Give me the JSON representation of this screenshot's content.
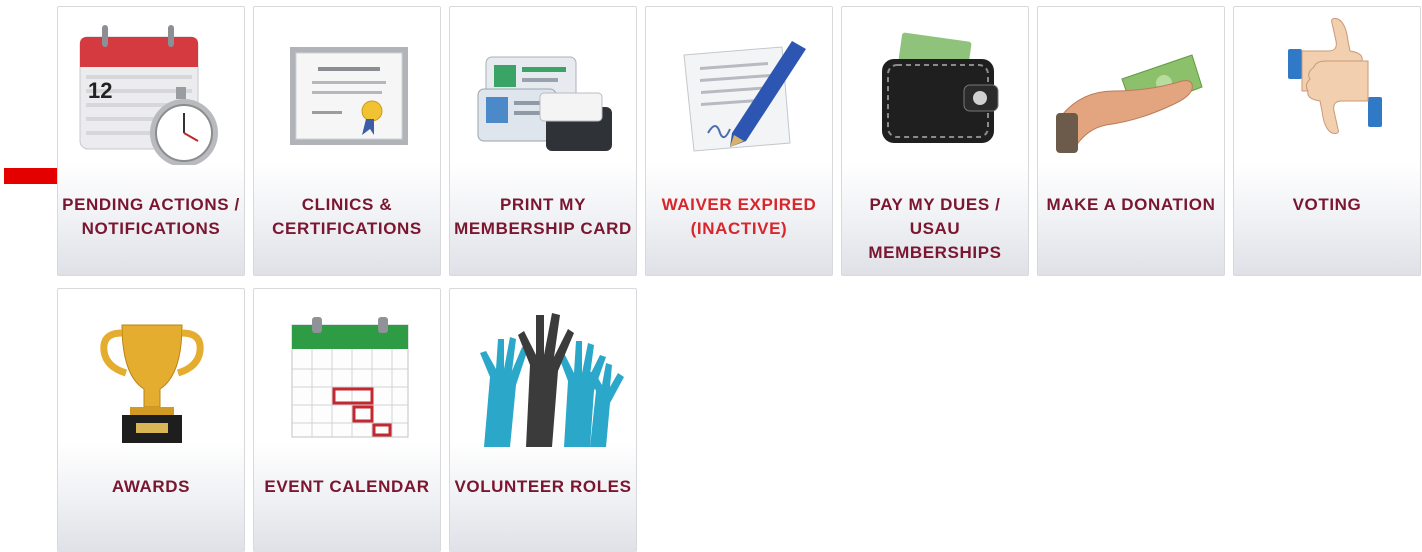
{
  "tiles": [
    {
      "icon": "calendar-stopwatch-icon",
      "label": "PENDING ACTIONS / NOTIFICATIONS",
      "calendar_day": "12"
    },
    {
      "icon": "certificate-icon",
      "label": "CLINICS & CERTIFICATIONS"
    },
    {
      "icon": "id-card-printer-icon",
      "label": "PRINT MY MEMBERSHIP CARD"
    },
    {
      "icon": "signed-waiver-pen-icon",
      "label": "WAIVER EXPIRED (INACTIVE)"
    },
    {
      "icon": "wallet-icon",
      "label": "PAY MY DUES / USAU MEMBERSHIPS"
    },
    {
      "icon": "hand-cash-icon",
      "label": "MAKE A DONATION"
    },
    {
      "icon": "thumbs-up-down-icon",
      "label": "VOTING"
    },
    {
      "icon": "trophy-icon",
      "label": "AWARDS"
    },
    {
      "icon": "event-calendar-icon",
      "label": "EVENT CALENDAR"
    },
    {
      "icon": "raised-hands-icon",
      "label": "VOLUNTEER ROLES"
    }
  ],
  "colors": {
    "label": "#7a1630",
    "alert": "#d7262c",
    "arrow": "#e50000"
  }
}
